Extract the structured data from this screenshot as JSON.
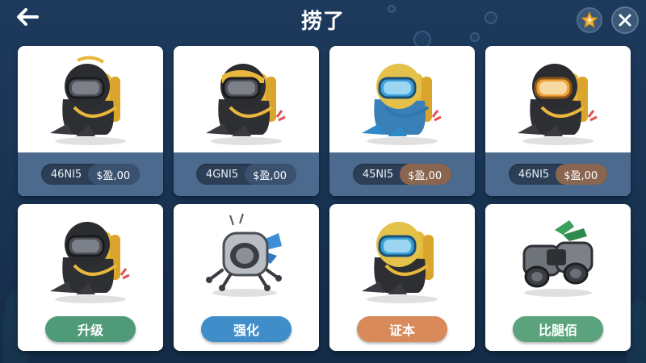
{
  "header": {
    "title": "捞了",
    "back_icon": "arrow-left-icon",
    "star_icon": "star-bolt-icon",
    "close_icon": "close-icon"
  },
  "colors": {
    "background": "#1d3a5c",
    "card_footer": "#4b6a8e",
    "star_gold": "#f0b23a",
    "button_green": "#4f9a78",
    "button_blue": "#3f8ec9",
    "button_orange": "#d88a5a"
  },
  "top_items": [
    {
      "code": "46NI5",
      "price": "$盈,00",
      "mask": "dark",
      "price_style": "blue"
    },
    {
      "code": "4GNI5",
      "price": "$盈,00",
      "mask": "gold",
      "price_style": "blue"
    },
    {
      "code": "45NI5",
      "price": "$盈,00",
      "mask": "blue",
      "price_style": "brown"
    },
    {
      "code": "46NI5",
      "price": "$盈,00",
      "mask": "orange",
      "price_style": "brown"
    }
  ],
  "bottom_items": [
    {
      "button": "升级",
      "art": "diver-dark",
      "button_style": "green"
    },
    {
      "button": "强化",
      "art": "drone",
      "button_style": "blue"
    },
    {
      "button": "证本",
      "art": "diver-blue",
      "button_style": "orange"
    },
    {
      "button": "比腿佰",
      "art": "binoculars",
      "button_style": "green2"
    }
  ]
}
